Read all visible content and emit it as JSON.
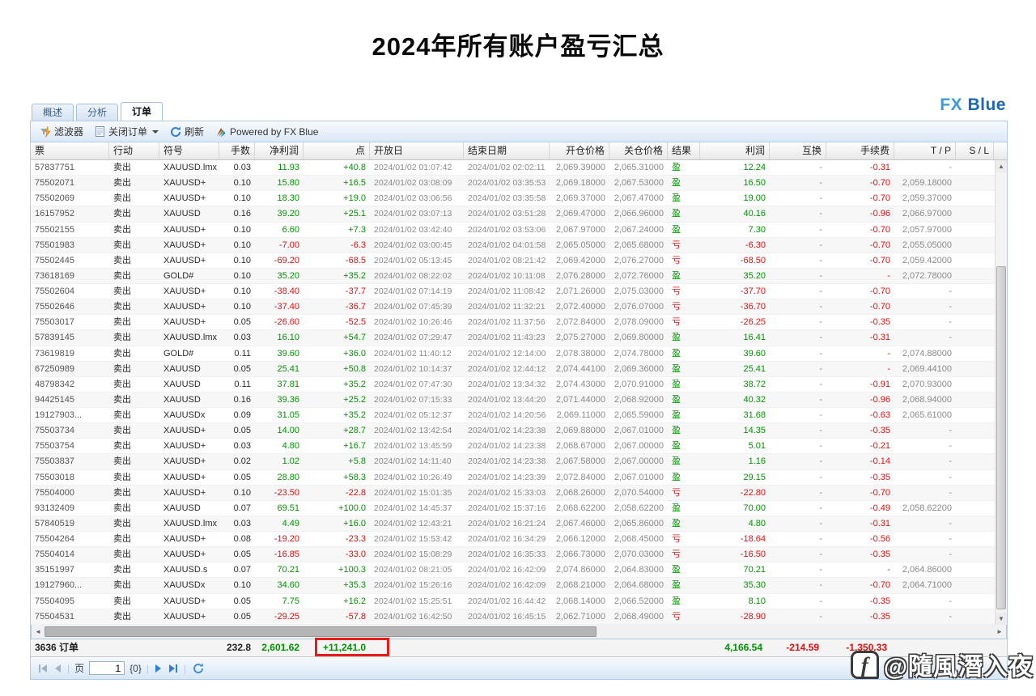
{
  "page": {
    "title": "2024年所有账户盈亏汇总"
  },
  "brand": {
    "fx": "FX",
    "blue": "Blue"
  },
  "tabs": [
    {
      "label": "概述",
      "active": false
    },
    {
      "label": "分析",
      "active": false
    },
    {
      "label": "订单",
      "active": true
    }
  ],
  "toolbar": {
    "filter": "滤波器",
    "close_orders": "关闭订单",
    "refresh": "刷新",
    "powered_by": "Powered by FX Blue"
  },
  "icons": {
    "filter": "funnel-with-lightning",
    "close_orders": "document",
    "close_orders_caret": "caret-down",
    "refresh": "circular-arrow",
    "powered_by": "fxblue-color-mark",
    "watermark_logo": "f-speech-bubble"
  },
  "table": {
    "headers": [
      "票",
      "行动",
      "符号",
      "手数",
      "净利润",
      "点",
      "开放日",
      "结束日期",
      "开仓价格",
      "关仓价格",
      "结果",
      "利润",
      "互换",
      "手续费",
      "T / P",
      "S / L"
    ],
    "rows": [
      [
        "57837751",
        "卖出",
        "XAUUSD.lmx",
        "0.03",
        "11.93",
        "+40.8",
        "2024/01/02 01:07:42",
        "2024/01/02 02:02:11",
        "2,069.39000",
        "2,065.31000",
        "盈",
        "12.24",
        "-",
        "-0.31",
        "-",
        ""
      ],
      [
        "75502071",
        "卖出",
        "XAUUSD+",
        "0.10",
        "15.80",
        "+16.5",
        "2024/01/02 03:08:09",
        "2024/01/02 03:35:53",
        "2,069.18000",
        "2,067.53000",
        "盈",
        "16.50",
        "-",
        "-0.70",
        "2,059.18000",
        ""
      ],
      [
        "75502069",
        "卖出",
        "XAUUSD+",
        "0.10",
        "18.30",
        "+19.0",
        "2024/01/02 03:06:56",
        "2024/01/02 03:35:58",
        "2,069.37000",
        "2,067.47000",
        "盈",
        "19.00",
        "-",
        "-0.70",
        "2,059.37000",
        ""
      ],
      [
        "16157952",
        "卖出",
        "XAUUSD",
        "0.16",
        "39.20",
        "+25.1",
        "2024/01/02 03:07:13",
        "2024/01/02 03:51:28",
        "2,069.47000",
        "2,066.96000",
        "盈",
        "40.16",
        "-",
        "-0.96",
        "2,066.97000",
        ""
      ],
      [
        "75502155",
        "卖出",
        "XAUUSD+",
        "0.10",
        "6.60",
        "+7.3",
        "2024/01/02 03:42:40",
        "2024/01/02 03:53:06",
        "2,067.97000",
        "2,067.24000",
        "盈",
        "7.30",
        "-",
        "-0.70",
        "2,057.97000",
        ""
      ],
      [
        "75501983",
        "卖出",
        "XAUUSD+",
        "0.10",
        "-7.00",
        "-6.3",
        "2024/01/02 03:00:45",
        "2024/01/02 04:01:58",
        "2,065.05000",
        "2,065.68000",
        "亏",
        "-6.30",
        "-",
        "-0.70",
        "2,055.05000",
        ""
      ],
      [
        "75502445",
        "卖出",
        "XAUUSD+",
        "0.10",
        "-69.20",
        "-68.5",
        "2024/01/02 05:13:45",
        "2024/01/02 08:21:42",
        "2,069.42000",
        "2,076.27000",
        "亏",
        "-68.50",
        "-",
        "-0.70",
        "2,059.42000",
        ""
      ],
      [
        "73618169",
        "卖出",
        "GOLD#",
        "0.10",
        "35.20",
        "+35.2",
        "2024/01/02 08:22:02",
        "2024/01/02 10:11:08",
        "2,076.28000",
        "2,072.76000",
        "盈",
        "35.20",
        "-",
        "-",
        "2,072.78000",
        ""
      ],
      [
        "75502604",
        "卖出",
        "XAUUSD+",
        "0.10",
        "-38.40",
        "-37.7",
        "2024/01/02 07:14:19",
        "2024/01/02 11:08:42",
        "2,071.26000",
        "2,075.03000",
        "亏",
        "-37.70",
        "-",
        "-0.70",
        "-",
        ""
      ],
      [
        "75502646",
        "卖出",
        "XAUUSD+",
        "0.10",
        "-37.40",
        "-36.7",
        "2024/01/02 07:45:39",
        "2024/01/02 11:32:21",
        "2,072.40000",
        "2,076.07000",
        "亏",
        "-36.70",
        "-",
        "-0.70",
        "-",
        ""
      ],
      [
        "75503017",
        "卖出",
        "XAUUSD+",
        "0.05",
        "-26.60",
        "-52.5",
        "2024/01/02 10:26:46",
        "2024/01/02 11:37:56",
        "2,072.84000",
        "2,078.09000",
        "亏",
        "-26.25",
        "-",
        "-0.35",
        "-",
        ""
      ],
      [
        "57839145",
        "卖出",
        "XAUUSD.lmx",
        "0.03",
        "16.10",
        "+54.7",
        "2024/01/02 07:29:47",
        "2024/01/02 11:43:23",
        "2,075.27000",
        "2,069.80000",
        "盈",
        "16.41",
        "-",
        "-0.31",
        "-",
        ""
      ],
      [
        "73619819",
        "卖出",
        "GOLD#",
        "0.11",
        "39.60",
        "+36.0",
        "2024/01/02 11:40:12",
        "2024/01/02 12:14:00",
        "2,078.38000",
        "2,074.78000",
        "盈",
        "39.60",
        "-",
        "-",
        "2,074.88000",
        ""
      ],
      [
        "67250989",
        "卖出",
        "XAUUSD",
        "0.05",
        "25.41",
        "+50.8",
        "2024/01/02 10:14:37",
        "2024/01/02 12:44:12",
        "2,074.44100",
        "2,069.36000",
        "盈",
        "25.41",
        "-",
        "-",
        "2,069.44100",
        ""
      ],
      [
        "48798342",
        "卖出",
        "XAUUSD",
        "0.11",
        "37.81",
        "+35.2",
        "2024/01/02 07:47:30",
        "2024/01/02 13:34:32",
        "2,074.43000",
        "2,070.91000",
        "盈",
        "38.72",
        "-",
        "-0.91",
        "2,070.93000",
        ""
      ],
      [
        "94425145",
        "卖出",
        "XAUUSD",
        "0.16",
        "39.36",
        "+25.2",
        "2024/01/02 07:15:33",
        "2024/01/02 13:44:20",
        "2,071.44000",
        "2,068.92000",
        "盈",
        "40.32",
        "-",
        "-0.96",
        "2,068.94000",
        ""
      ],
      [
        "19127903...",
        "卖出",
        "XAUUSDx",
        "0.09",
        "31.05",
        "+35.2",
        "2024/01/02 05:12:37",
        "2024/01/02 14:20:56",
        "2,069.11000",
        "2,065.59000",
        "盈",
        "31.68",
        "-",
        "-0.63",
        "2,065.61000",
        ""
      ],
      [
        "75503734",
        "卖出",
        "XAUUSD+",
        "0.05",
        "14.00",
        "+28.7",
        "2024/01/02 13:42:54",
        "2024/01/02 14:23:38",
        "2,069.88000",
        "2,067.01000",
        "盈",
        "14.35",
        "-",
        "-0.35",
        "-",
        ""
      ],
      [
        "75503754",
        "卖出",
        "XAUUSD+",
        "0.03",
        "4.80",
        "+16.7",
        "2024/01/02 13:45:59",
        "2024/01/02 14:23:38",
        "2,068.67000",
        "2,067.00000",
        "盈",
        "5.01",
        "-",
        "-0.21",
        "-",
        ""
      ],
      [
        "75503837",
        "卖出",
        "XAUUSD+",
        "0.02",
        "1.02",
        "+5.8",
        "2024/01/02 14:11:40",
        "2024/01/02 14:23:38",
        "2,067.58000",
        "2,067.00000",
        "盈",
        "1.16",
        "-",
        "-0.14",
        "-",
        ""
      ],
      [
        "75503018",
        "卖出",
        "XAUUSD+",
        "0.05",
        "28.80",
        "+58.3",
        "2024/01/02 10:26:49",
        "2024/01/02 14:23:39",
        "2,072.84000",
        "2,067.01000",
        "盈",
        "29.15",
        "-",
        "-0.35",
        "-",
        ""
      ],
      [
        "75504000",
        "卖出",
        "XAUUSD+",
        "0.10",
        "-23.50",
        "-22.8",
        "2024/01/02 15:01:35",
        "2024/01/02 15:33:03",
        "2,068.26000",
        "2,070.54000",
        "亏",
        "-22.80",
        "-",
        "-0.70",
        "-",
        ""
      ],
      [
        "93132409",
        "卖出",
        "XAUUSD",
        "0.07",
        "69.51",
        "+100.0",
        "2024/01/02 14:45:37",
        "2024/01/02 15:37:16",
        "2,068.62200",
        "2,058.62200",
        "盈",
        "70.00",
        "-",
        "-0.49",
        "2,058.62200",
        ""
      ],
      [
        "57840519",
        "卖出",
        "XAUUSD.lmx",
        "0.03",
        "4.49",
        "+16.0",
        "2024/01/02 12:43:21",
        "2024/01/02 16:21:24",
        "2,067.46000",
        "2,065.86000",
        "盈",
        "4.80",
        "-",
        "-0.31",
        "-",
        ""
      ],
      [
        "75504264",
        "卖出",
        "XAUUSD+",
        "0.08",
        "-19.20",
        "-23.3",
        "2024/01/02 15:53:42",
        "2024/01/02 16:34:29",
        "2,066.12000",
        "2,068.45000",
        "亏",
        "-18.64",
        "-",
        "-0.56",
        "-",
        ""
      ],
      [
        "75504014",
        "卖出",
        "XAUUSD+",
        "0.05",
        "-16.85",
        "-33.0",
        "2024/01/02 15:08:29",
        "2024/01/02 16:35:33",
        "2,066.73000",
        "2,070.03000",
        "亏",
        "-16.50",
        "-",
        "-0.35",
        "-",
        ""
      ],
      [
        "35151997",
        "卖出",
        "XAUUSD.s",
        "0.07",
        "70.21",
        "+100.3",
        "2024/01/02 08:21:05",
        "2024/01/02 16:42:09",
        "2,074.86000",
        "2,064.83000",
        "盈",
        "70.21",
        "-",
        "-",
        "2,064.86000",
        ""
      ],
      [
        "19127960...",
        "卖出",
        "XAUUSDx",
        "0.10",
        "34.60",
        "+35.3",
        "2024/01/02 15:26:16",
        "2024/01/02 16:42:09",
        "2,068.21000",
        "2,064.68000",
        "盈",
        "35.30",
        "-",
        "-0.70",
        "2,064.71000",
        ""
      ],
      [
        "75504095",
        "卖出",
        "XAUUSD+",
        "0.05",
        "7.75",
        "+16.2",
        "2024/01/02 15:25:51",
        "2024/01/02 16:44:42",
        "2,068.14000",
        "2,066.52000",
        "盈",
        "8.10",
        "-",
        "-0.35",
        "-",
        ""
      ],
      [
        "75504531",
        "卖出",
        "XAUUSD+",
        "0.05",
        "-29.25",
        "-57.8",
        "2024/01/02 16:42:50",
        "2024/01/02 16:45:15",
        "2,062.71000",
        "2,068.49000",
        "亏",
        "-28.90",
        "-",
        "-0.35",
        "-",
        ""
      ]
    ]
  },
  "summary": {
    "orders": "3636 订单",
    "lots": "232.8",
    "net_profit": "2,601.62",
    "points": "+11,241.0",
    "profit": "4,166.54",
    "swap": "-214.59",
    "commission": "-1,350.33"
  },
  "pagination": {
    "label": "页",
    "value": "1",
    "suffix": "{0}"
  },
  "watermark": {
    "logo": "f",
    "handle": "@隨風潛入夜"
  },
  "colors": {
    "profit_green": "#009400",
    "loss_red": "#dd1111",
    "accent_blue": "#1b67b3",
    "annotation_red": "#e31c1c"
  }
}
